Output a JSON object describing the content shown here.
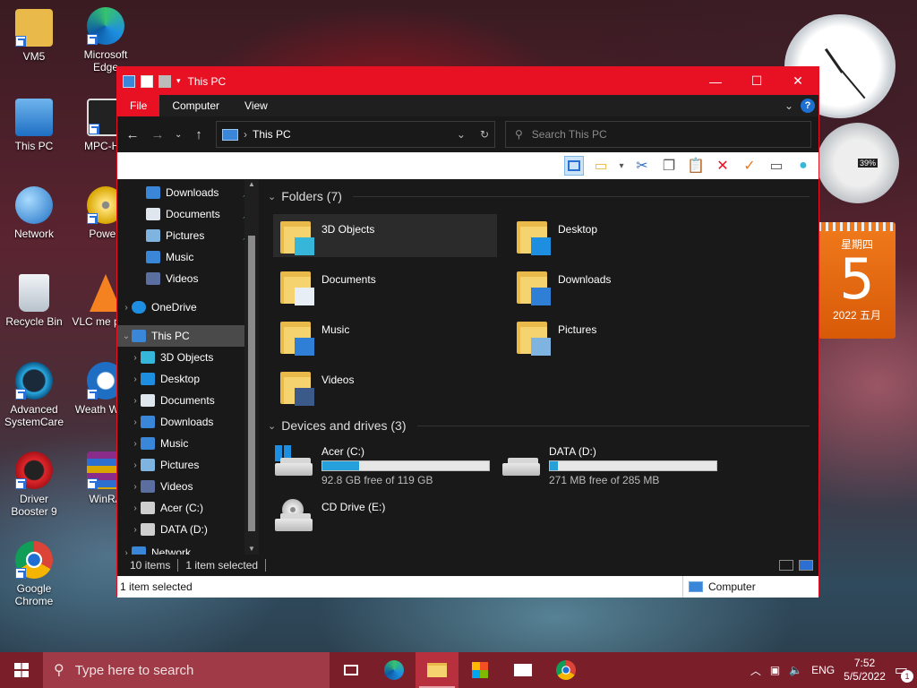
{
  "desktop": {
    "icons": [
      {
        "label": "VM5"
      },
      {
        "label": "Microsoft Edge"
      },
      {
        "label": "This PC"
      },
      {
        "label": "MPC-HC"
      },
      {
        "label": "Network"
      },
      {
        "label": "PowerI"
      },
      {
        "label": "Recycle Bin"
      },
      {
        "label": "VLC me playe"
      },
      {
        "label": "Advanced SystemCare"
      },
      {
        "label": "Weath Wizar"
      },
      {
        "label": "Driver Booster 9"
      },
      {
        "label": "WinRA"
      },
      {
        "label": "Google Chrome"
      }
    ],
    "gadgets": {
      "meter_percent": "39%",
      "calendar_weekday": "星期四",
      "calendar_day": "5",
      "calendar_month_year": "2022 五月"
    }
  },
  "window": {
    "title": "This PC",
    "ribbon_tabs": [
      "File",
      "Computer",
      "View"
    ],
    "address_text": "This PC",
    "search_placeholder": "Search This PC",
    "nav": {
      "quick_access": [
        {
          "label": "Downloads",
          "pinned": true,
          "color": "#3a86d8"
        },
        {
          "label": "Documents",
          "pinned": true,
          "color": "#dfe6ee"
        },
        {
          "label": "Pictures",
          "pinned": true,
          "color": "#7fb3e0"
        },
        {
          "label": "Music",
          "pinned": false,
          "color": "#3a86d8"
        },
        {
          "label": "Videos",
          "pinned": false,
          "color": "#5a6fa0"
        }
      ],
      "onedrive": "OneDrive",
      "this_pc": "This PC",
      "this_pc_children": [
        {
          "label": "3D Objects",
          "color": "#36b7d9"
        },
        {
          "label": "Desktop",
          "color": "#1e8fe0"
        },
        {
          "label": "Documents",
          "color": "#dfe6ee"
        },
        {
          "label": "Downloads",
          "color": "#3a86d8"
        },
        {
          "label": "Music",
          "color": "#3a86d8"
        },
        {
          "label": "Pictures",
          "color": "#7fb3e0"
        },
        {
          "label": "Videos",
          "color": "#5a6fa0"
        },
        {
          "label": "Acer (C:)",
          "color": "#cfcfcf"
        },
        {
          "label": "DATA (D:)",
          "color": "#cfcfcf"
        }
      ],
      "network": "Network"
    },
    "folders_header": "Folders (7)",
    "folders": [
      {
        "name": "3D Objects",
        "overlay": "#36b7d9"
      },
      {
        "name": "Desktop",
        "overlay": "#1e8fe0"
      },
      {
        "name": "Documents",
        "overlay": "#e8eef5"
      },
      {
        "name": "Downloads",
        "overlay": "#2f7fd6"
      },
      {
        "name": "Music",
        "overlay": "#2f7fd6"
      },
      {
        "name": "Pictures",
        "overlay": "#7fb3e0"
      },
      {
        "name": "Videos",
        "overlay": "#3b5a8a"
      }
    ],
    "drives_header": "Devices and drives (3)",
    "drives": [
      {
        "name": "Acer (C:)",
        "free": "92.8 GB free of 119 GB",
        "used_fraction": 0.22,
        "kind": "system"
      },
      {
        "name": "DATA (D:)",
        "free": "271 MB free of 285 MB",
        "used_fraction": 0.05,
        "kind": "hdd"
      },
      {
        "name": "CD Drive (E:)",
        "free": "",
        "used_fraction": null,
        "kind": "cd"
      }
    ],
    "status": {
      "items": "10 items",
      "selected": "1 item selected",
      "bottom_selected": "1 item selected",
      "bottom_location": "Computer"
    }
  },
  "taskbar": {
    "search_placeholder": "Type here to search",
    "language": "ENG",
    "time": "7:52",
    "date": "5/5/2022",
    "notification_count": "1"
  },
  "colors": {
    "accent": "#e81123",
    "taskbar": "#7a1e2a",
    "drive_bar": "#26a0da"
  }
}
